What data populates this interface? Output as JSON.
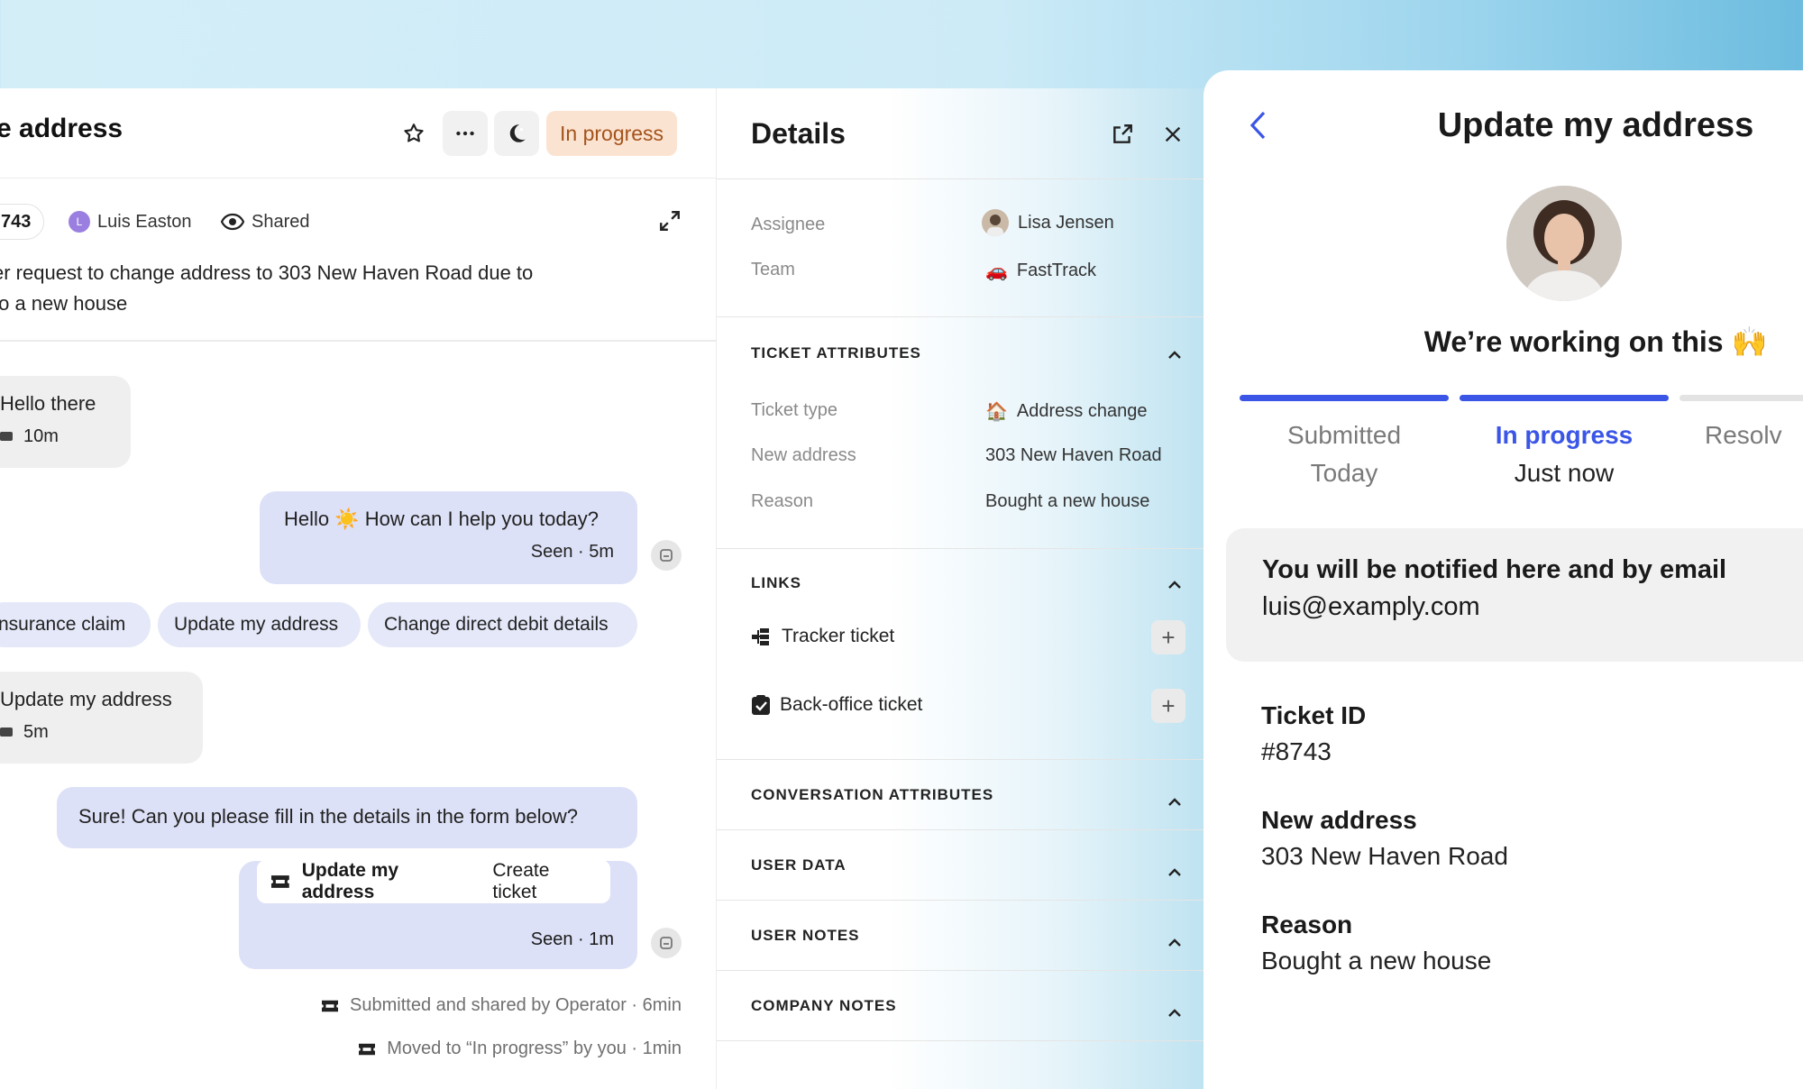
{
  "conversation": {
    "title": "te address",
    "status": "In progress",
    "ticket_id_short": "743",
    "author": "Luis Easton",
    "author_initial": "L",
    "visibility": "Shared",
    "description_line1": "er request to change address to 303 New Haven Road due to",
    "description_line2": "to a new house",
    "messages": {
      "m1_text": "Hello there",
      "m1_time": "10m",
      "m2_text": "Hello ☀️ How can I help you today?",
      "m2_meta": "Seen ·  5m",
      "chips": [
        "nsurance claim",
        "Update my address",
        "Change direct debit details"
      ],
      "m3_text": "Update my address",
      "m3_time": "5m",
      "m4_text": "Sure! Can you please fill in the details in the form below?",
      "ticket_title": "Update my address",
      "ticket_action": "Create ticket",
      "m5_meta": "Seen ·  1m"
    },
    "events": [
      "Submitted and shared by Operator · 6min",
      "Moved to “In progress” by you · 1min"
    ]
  },
  "details": {
    "title": "Details",
    "assignee_label": "Assignee",
    "assignee_value": "Lisa Jensen",
    "team_label": "Team",
    "team_value": "FastTrack",
    "team_icon": "🚗",
    "ticket_attributes_heading": "TICKET ATTRIBUTES",
    "ticket_type_label": "Ticket type",
    "ticket_type_value": "Address change",
    "ticket_type_icon": "🏠",
    "new_address_label": "New address",
    "new_address_value": "303 New Haven Road",
    "reason_label": "Reason",
    "reason_value": "Bought a new house",
    "links_heading": "LINKS",
    "tracker_ticket": "Tracker ticket",
    "backoffice_ticket": "Back-office ticket",
    "sections": [
      "CONVERSATION ATTRIBUTES",
      "USER DATA",
      "USER NOTES",
      "COMPANY NOTES"
    ]
  },
  "messenger": {
    "title": "Update my address",
    "working": "We’re working on this 🙌",
    "progress": {
      "completed_steps": 2,
      "total_steps": 3
    },
    "steps": [
      {
        "label": "Submitted",
        "sub": "Today"
      },
      {
        "label": "In progress",
        "sub": "Just now"
      },
      {
        "label": "Resolv",
        "sub": ""
      }
    ],
    "notify_title": "You will be notified here and by email",
    "notify_email": "luis@examply.com",
    "fields": [
      {
        "label": "Ticket ID",
        "value": "#8743"
      },
      {
        "label": "New address",
        "value": "303 New Haven Road"
      },
      {
        "label": "Reason",
        "value": "Bought a new house"
      }
    ]
  },
  "colors": {
    "accent": "#3b55e6",
    "status_bg": "#fbe3d2",
    "status_text": "#a4531b",
    "bubble_out": "#dde1f7",
    "bubble_in": "#efefef"
  }
}
